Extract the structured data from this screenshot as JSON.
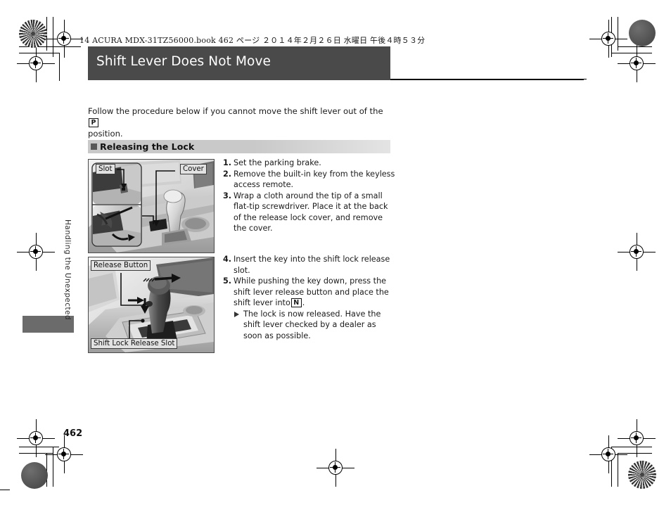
{
  "page": {
    "book_header": "14 ACURA  MDX-31TZ56000.book   462 ページ   ２０１４年２月２６日   水曜日   午後４時５３分",
    "folio": "462",
    "chapter_tab": "Handling the Unexpected"
  },
  "title": {
    "text": "Shift Lever Does Not Move"
  },
  "intro": {
    "before": "Follow the procedure below if you cannot move the shift lever out of the",
    "gear_badge": "P",
    "after": "position."
  },
  "section": {
    "heading": "Releasing the Lock"
  },
  "steps_group_a": [
    {
      "num": "1.",
      "text": "Set the parking brake."
    },
    {
      "num": "2.",
      "text": "Remove the built-in key from the keyless access remote."
    },
    {
      "num": "3.",
      "text": "Wrap a cloth around the tip of a small flat-tip screwdriver. Place it at the back of the release lock cover, and remove the cover."
    }
  ],
  "steps_group_b": [
    {
      "num": "4.",
      "text": "Insert the key into the shift lock release slot."
    },
    {
      "num": "5.",
      "text": "While pushing the key down, press the shift lever release button and place the shift lever into"
    }
  ],
  "step5": {
    "gear_badge": "N",
    "period": ".",
    "note": "The lock is now released. Have the shift lever checked by a dealer as soon as possible."
  },
  "figure_a": {
    "label_slot": "Slot",
    "label_cover": "Cover"
  },
  "figure_b": {
    "label_release_button": "Release Button",
    "label_release_slot": "Shift Lock Release Slot"
  },
  "colors": {
    "title_bar": "#4a4a4a",
    "section_band": "#c9c9c9",
    "side_tab": "#6b6b6b"
  }
}
